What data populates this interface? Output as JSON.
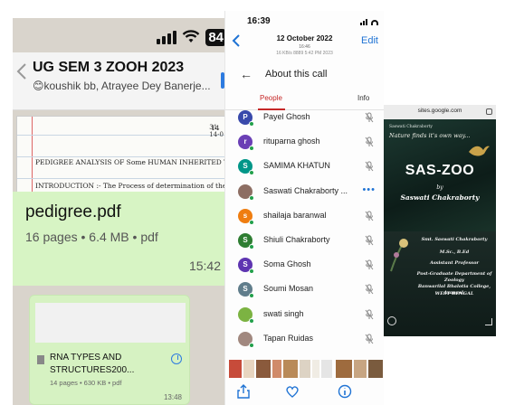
{
  "whatsapp": {
    "status_battery": "84",
    "group_title": "UG SEM 3 ZOOH 2023",
    "group_members": "😊koushik bb, Atrayee Dey Banerje...",
    "doc_preview": {
      "corner_date": "14-0",
      "corner_num": "31",
      "line1": "PEDIGREE  ANALYSIS  OF  Some  HUMAN  INHERITED  TR",
      "line2": "INTRODUCTION :-  The  Process  of  determination  of  the",
      "line3": "14"
    },
    "pdf_message": {
      "name": "pedigree.pdf",
      "meta": "16 pages • 6.4 MB • pdf",
      "time": "15:42"
    },
    "rna_message": {
      "name": "RNA TYPES AND STRUCTURES200...",
      "meta": "14 pages • 630 KB • pdf",
      "time": "13:48"
    }
  },
  "call": {
    "time": "16:39",
    "date": "12 October 2022",
    "date_sub": "16:46",
    "edit_label": "Edit",
    "cut_text": "16 KB/s 8889          5:42 PM          2023",
    "about_title": "About this call",
    "tab_people": "People",
    "tab_info": "Info",
    "participants": [
      {
        "name": "Payel Ghosh",
        "initial": "P",
        "color": "#3949ab"
      },
      {
        "name": "rituparna ghosh",
        "initial": "r",
        "color": "#6a3fb5"
      },
      {
        "name": "SAMIMA KHATUN",
        "initial": "S",
        "color": "#009688"
      },
      {
        "name": "Saswati Chakraborty ...",
        "initial": "",
        "color": "#8d6e63"
      },
      {
        "name": "shailaja baranwal",
        "initial": "s",
        "color": "#ef7d10"
      },
      {
        "name": "Shiuli Chakraborty",
        "initial": "S",
        "color": "#2e7d32"
      },
      {
        "name": "Soma Ghosh",
        "initial": "S",
        "color": "#5e35b1"
      },
      {
        "name": "Soumi Mosan",
        "initial": "S",
        "color": "#607d8b"
      },
      {
        "name": "swati singh",
        "initial": "",
        "color": "#7cb342"
      },
      {
        "name": "Tapan Ruidas",
        "initial": "",
        "color": "#a1887f"
      }
    ],
    "more_label": "•••"
  },
  "site": {
    "url": "sites.google.com",
    "tagline_small": "Saswati Chakraborty",
    "tagline": "Nature finds it's own way...",
    "title": "SAS-ZOO",
    "by": "by",
    "author": "Saswati Chakraborty",
    "info": {
      "name": "Smt. Saswati Chakraborty",
      "degree": "M.Sc., B.Ed",
      "post": "Assistant Professor",
      "dept": "Post-Graduate Department of Zoology",
      "college": "Banwarilal Bhalotia College, Asansol,",
      "state": "WEST BENGAL"
    }
  },
  "colors": {
    "whatsapp_bubble": "#d7f4c4",
    "ios_blue": "#1f73d4",
    "meet_red": "#c62828"
  }
}
